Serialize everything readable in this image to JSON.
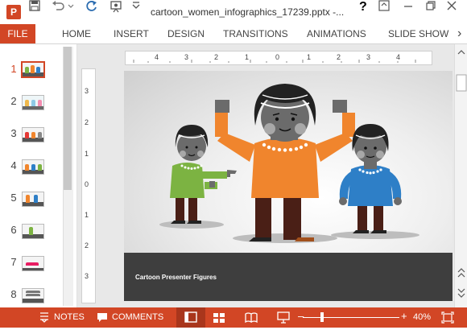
{
  "window": {
    "title": "cartoon_women_infographics_17239.pptx -...",
    "app_letter": "P",
    "help_label": "?",
    "icons": [
      "save-icon",
      "undo-icon",
      "undo-dropdown-icon",
      "redo-icon",
      "present-icon",
      "customize-icon",
      "ribbon-display-icon",
      "minimize-icon",
      "restore-icon",
      "close-icon"
    ]
  },
  "ribbon": {
    "file": "FILE",
    "tabs": [
      "HOME",
      "INSERT",
      "DESIGN",
      "TRANSITIONS",
      "ANIMATIONS",
      "SLIDE SHOW"
    ],
    "more": "›"
  },
  "thumbnails": {
    "numbers": [
      "1",
      "2",
      "3",
      "4",
      "5",
      "6",
      "7",
      "8"
    ],
    "selected": "1"
  },
  "rulers": {
    "horizontal": [
      "4",
      "3",
      "2",
      "1",
      "0",
      "1",
      "2",
      "3",
      "4"
    ],
    "vertical": [
      "3",
      "2",
      "1",
      "0",
      "1",
      "2",
      "3"
    ]
  },
  "slide": {
    "caption": "Cartoon Presenter Figures"
  },
  "colors": {
    "accent": "#d24625",
    "shirt_green": "#7cb342",
    "shirt_orange": "#f0852d",
    "shirt_blue": "#2e7fc7",
    "skin": "#6b6b6b",
    "pants": "#4a1f16"
  },
  "status": {
    "notes": "NOTES",
    "comments": "COMMENTS",
    "zoom_minus": "–",
    "zoom_plus": "+",
    "zoom": "40%"
  }
}
